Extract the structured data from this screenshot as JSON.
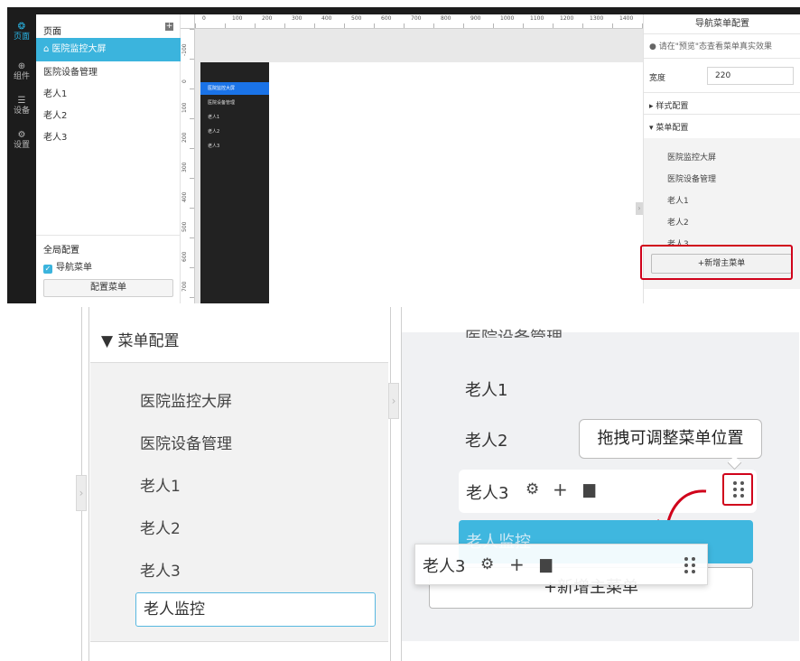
{
  "editor": {
    "nav": [
      {
        "icon": "layers-icon",
        "glyph": "❂",
        "label": "页面"
      },
      {
        "icon": "cube-icon",
        "glyph": "⊕",
        "label": "组件"
      },
      {
        "icon": "device-icon",
        "glyph": "☰",
        "label": "设备"
      },
      {
        "icon": "gear-icon",
        "glyph": "⚙",
        "label": "设置"
      }
    ],
    "pages_title": "页面",
    "pages_add": "+",
    "pages": [
      {
        "label": "医院监控大屏",
        "icon": "⌂"
      },
      {
        "label": "医院设备管理"
      },
      {
        "label": "老人1"
      },
      {
        "label": "老人2"
      },
      {
        "label": "老人3"
      }
    ],
    "global_title": "全局配置",
    "nav_menu_check": "导航菜单",
    "config_menu_button": "配置菜单",
    "ruler_h": [
      "0",
      "100",
      "200",
      "300",
      "400",
      "500",
      "600",
      "700",
      "800",
      "900",
      "1000",
      "1100",
      "1200",
      "1300",
      "1400"
    ],
    "ruler_v": [
      "-100",
      "0",
      "100",
      "200",
      "300",
      "400",
      "500",
      "600",
      "700"
    ],
    "preview_menu": [
      "医院监控大屏",
      "医院设备管理",
      "老人1",
      "老人2",
      "老人3"
    ],
    "right_panel": {
      "title": "导航菜单配置",
      "tip": "请在\"预览\"态查看菜单真实效果",
      "width_label": "宽度",
      "width_value": "220",
      "style_section": "▸ 样式配置",
      "menu_section": "▾ 菜单配置",
      "menu_items": [
        "医院监控大屏",
        "医院设备管理",
        "老人1",
        "老人2",
        "老人3"
      ],
      "add_button": "+新增主菜单"
    }
  },
  "zoom": {
    "left_header": "▼ 菜单配置",
    "left_items": [
      "医院监控大屏",
      "医院设备管理",
      "老人1",
      "老人2",
      "老人3"
    ],
    "left_input_value": "老人监控",
    "right_top_partial": "医院设备管理",
    "right_items": [
      "老人1",
      "老人2"
    ],
    "tooltip": "拖拽可调整菜单位置",
    "row3_label": "老人3",
    "highlight_item": "老人监控",
    "add_button": "+新增主菜单",
    "ghost_label": "老人3",
    "arrow_glyph": "›"
  },
  "colors": {
    "accent": "#3bb4dd",
    "highlight_red": "#d0021b",
    "dark": "#1c1c1c"
  }
}
